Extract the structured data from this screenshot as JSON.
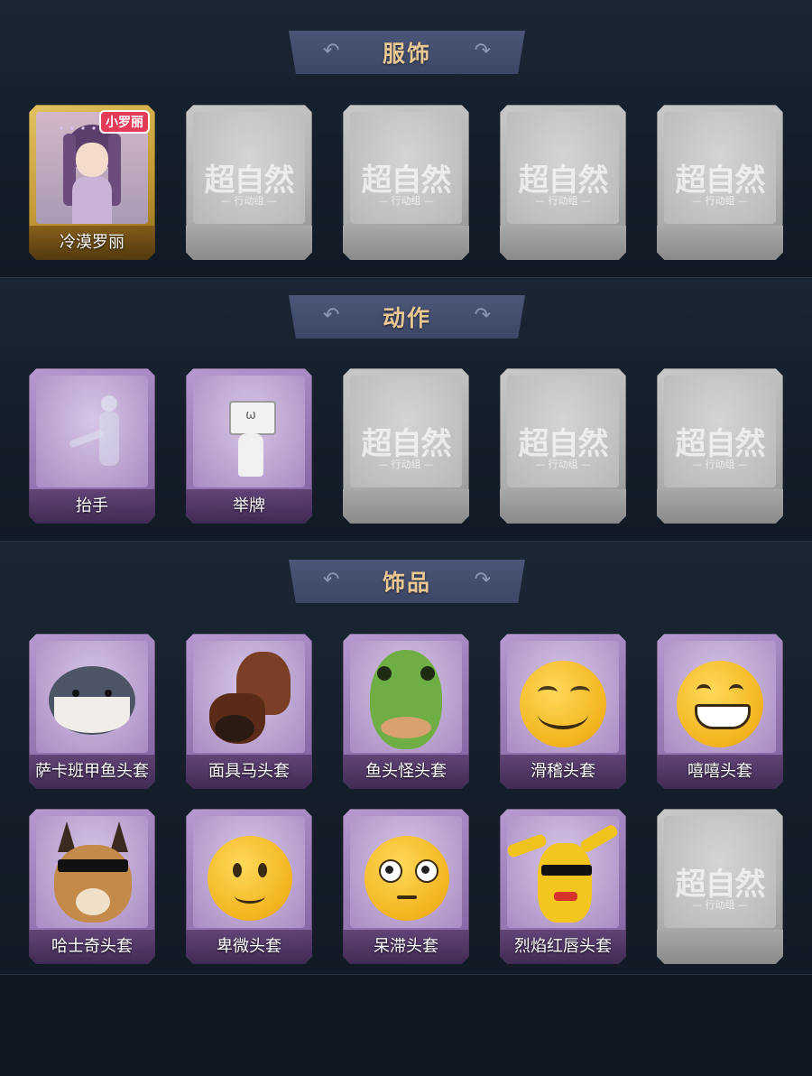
{
  "sections": {
    "outfit": {
      "title": "服饰"
    },
    "action": {
      "title": "动作"
    },
    "accessory": {
      "title": "饰品"
    }
  },
  "placeholder": {
    "brand": "超自然",
    "sub": "— 行动组 —"
  },
  "outfit_items": [
    {
      "label": "冷漠罗丽",
      "badge": "小罗丽"
    }
  ],
  "action_items": [
    {
      "label": "抬手"
    },
    {
      "label": "举牌"
    }
  ],
  "accessory_items": [
    {
      "label": "萨卡班甲鱼头套"
    },
    {
      "label": "面具马头套"
    },
    {
      "label": "鱼头怪头套"
    },
    {
      "label": "滑稽头套"
    },
    {
      "label": "嘻嘻头套"
    },
    {
      "label": "哈士奇头套"
    },
    {
      "label": "卑微头套"
    },
    {
      "label": "呆滞头套"
    },
    {
      "label": "烈焰红唇头套"
    }
  ]
}
